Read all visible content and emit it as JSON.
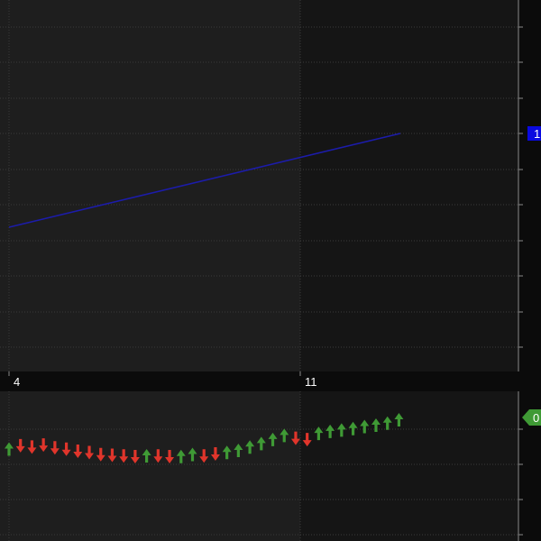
{
  "theme": {
    "background": "#0b0b0b",
    "pane_left_bg": "#1e1e1e",
    "pane_right_bg": "#151515",
    "grid": "#3a3a3a",
    "axis_line": "#8a8a8a",
    "price_line": "#1c1caa",
    "price_tag": "#0a0ae0",
    "up_arrow": "#3f9a35",
    "down_arrow": "#e0352b",
    "indicator_tag": "#3f9a35"
  },
  "chart_data": [
    {
      "type": "line",
      "pane": "price",
      "series": [
        {
          "color": "#1c1caa",
          "x": [
            0,
            21.5
          ],
          "y": [
            0.3,
            1.8
          ]
        }
      ],
      "x_ticks": [
        {
          "x": 0,
          "label": "4"
        },
        {
          "x": 16,
          "label": "11"
        }
      ],
      "last_value_tag": {
        "label": "1",
        "y": 1.8
      },
      "grid": true
    },
    {
      "type": "scatter",
      "pane": "indicator",
      "marker": "arrow",
      "up_color": "#3f9a35",
      "down_color": "#e0352b",
      "x": [
        0,
        0.63,
        1.26,
        1.89,
        2.52,
        3.15,
        3.78,
        4.41,
        5.04,
        5.67,
        6.3,
        6.93,
        7.56,
        8.19,
        8.82,
        9.45,
        10.08,
        10.71,
        11.34,
        11.97,
        12.6,
        13.23,
        13.86,
        14.49,
        15.12,
        15.75,
        16.38,
        17.01,
        17.64,
        18.27,
        18.9,
        19.53,
        20.16,
        20.79,
        21.42
      ],
      "y": [
        0.52,
        0.58,
        0.56,
        0.59,
        0.55,
        0.53,
        0.5,
        0.48,
        0.45,
        0.44,
        0.43,
        0.42,
        0.42,
        0.43,
        0.42,
        0.41,
        0.44,
        0.43,
        0.46,
        0.47,
        0.5,
        0.55,
        0.6,
        0.66,
        0.72,
        0.69,
        0.67,
        0.75,
        0.78,
        0.8,
        0.82,
        0.85,
        0.87,
        0.9,
        0.95
      ],
      "direction": [
        "up",
        "down",
        "down",
        "down",
        "down",
        "down",
        "down",
        "down",
        "down",
        "down",
        "down",
        "down",
        "up",
        "down",
        "down",
        "up",
        "up",
        "down",
        "down",
        "up",
        "up",
        "up",
        "up",
        "up",
        "up",
        "down",
        "down",
        "up",
        "up",
        "up",
        "up",
        "up",
        "up",
        "up",
        "up"
      ],
      "last_value_tag": {
        "label": "0"
      },
      "grid": true
    }
  ]
}
